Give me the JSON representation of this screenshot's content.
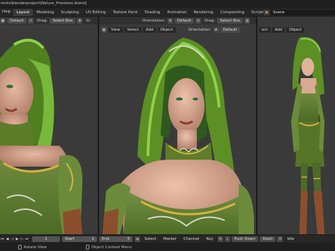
{
  "window": {
    "title": "rents\\blenderproject\\Nature_Priestess.blend]"
  },
  "topbar": {
    "menus": [
      "Help"
    ],
    "workspaces": [
      "Layout",
      "Modeling",
      "Sculpting",
      "UV Editing",
      "Texture Paint",
      "Shading",
      "Animation",
      "Rendering",
      "Compositing",
      "Scripting"
    ],
    "active_workspace": "Layout",
    "scene": "Scene"
  },
  "viewports": {
    "left": {
      "header": {
        "orientation_value": "Default",
        "drag_label": "Drag:",
        "drag_value": "Select Box",
        "extra": "Gl"
      }
    },
    "center": {
      "header": {
        "orientation_label": "Orientation:",
        "orientation_value": "Default",
        "drag_label": "Drag:",
        "drag_value": "Select Box"
      },
      "menus": [
        "View",
        "Select",
        "Add",
        "Object"
      ],
      "right_header": {
        "orientation_label": "Orientation:",
        "orientation_value": "Default"
      }
    },
    "right": {
      "menus": [
        "ect",
        "Add",
        "Object"
      ]
    }
  },
  "timeline": {
    "current_frame": "1",
    "start_label": "Start",
    "start_value": "1",
    "end_label": "End",
    "end_value": "5",
    "menus": [
      "Select",
      "Marker",
      "Channel",
      "Key"
    ],
    "push_down": "Push Down",
    "stash": "Stash",
    "action": "Idle"
  },
  "statusbar": {
    "rotate_view": "Rotate View",
    "object_context_menu": "Object Context Menu"
  },
  "colors": {
    "accent": "#4772b3",
    "dress_green": "#5a7a2e",
    "hood_green": "#6fae2e",
    "background": "#3a3a3a"
  }
}
